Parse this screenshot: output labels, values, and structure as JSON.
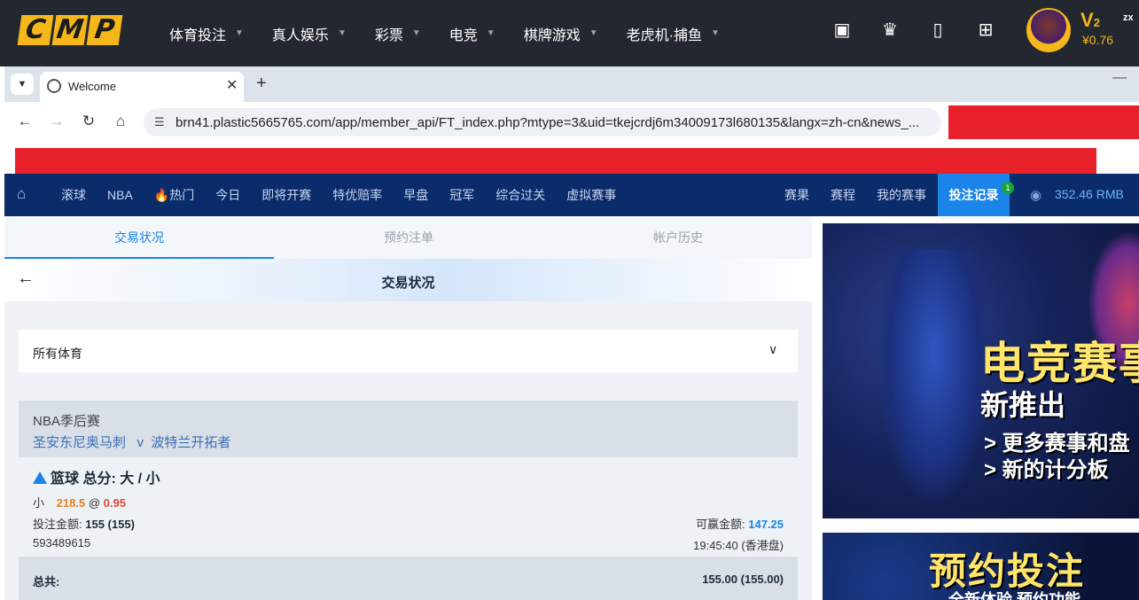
{
  "site": {
    "logo_letters": [
      "C",
      "M",
      "P"
    ],
    "nav": [
      "体育投注",
      "真人娱乐",
      "彩票",
      "电竞",
      "棋牌游戏",
      "老虎机·捕鱼"
    ],
    "icons": [
      "ticket-icon",
      "crown-icon",
      "mobile-icon",
      "gift-icon"
    ],
    "vip_level": "V",
    "vip_num": "2",
    "balance": "¥0.76",
    "username_fragment": "zx",
    "accent": "#f5b719"
  },
  "browser": {
    "tab_title": "Welcome",
    "url": "brn41.plastic5665765.com/app/member_api/FT_index.php?mtype=3&uid=tkejcrdj6m34009173l680135&langx=zh-cn&news_..."
  },
  "sportsbook": {
    "nav_links": [
      "滚球",
      "NBA",
      "🔥热门",
      "今日",
      "即将开赛",
      "特优赔率",
      "早盘",
      "冠军",
      "综合过关",
      "虚拟赛事"
    ],
    "right_links": [
      "赛果",
      "赛程",
      "我的赛事"
    ],
    "bet_record": "投注记录",
    "bet_record_badge": "1",
    "balance": "352.46",
    "currency": "RMB",
    "accent": "#1a84e8",
    "nav_bg": "#0a2c6b"
  },
  "panel": {
    "subtabs": [
      "交易状况",
      "预约注单",
      "帐户历史"
    ],
    "page_title": "交易状况",
    "sport_filter": "所有体育",
    "bet": {
      "league": "NBA季后赛",
      "home": "圣安东尼奥马刺",
      "vs": "v",
      "away": "波特兰开拓者",
      "market": "篮球 总分: 大 / 小",
      "selection": "小",
      "line": "218.5",
      "at": "@",
      "odds": "0.95",
      "stake_label": "投注金额:",
      "stake_value": "155 (155)",
      "win_label": "可赢金额:",
      "win_value": "147.25",
      "ticket_id": "593489615",
      "time": "19:45:40 (香港盘)"
    },
    "total_label": "总共:",
    "total_value": "155.00 (155.00)"
  },
  "banners": {
    "esports_title": "电竞赛事",
    "esports_subtitle": "新推出",
    "esports_line1": "> 更多赛事和盘",
    "esports_line2": "> 新的计分板",
    "preorder_title": "预约投注",
    "preorder_subtitle": "全新体验 预约功能"
  }
}
